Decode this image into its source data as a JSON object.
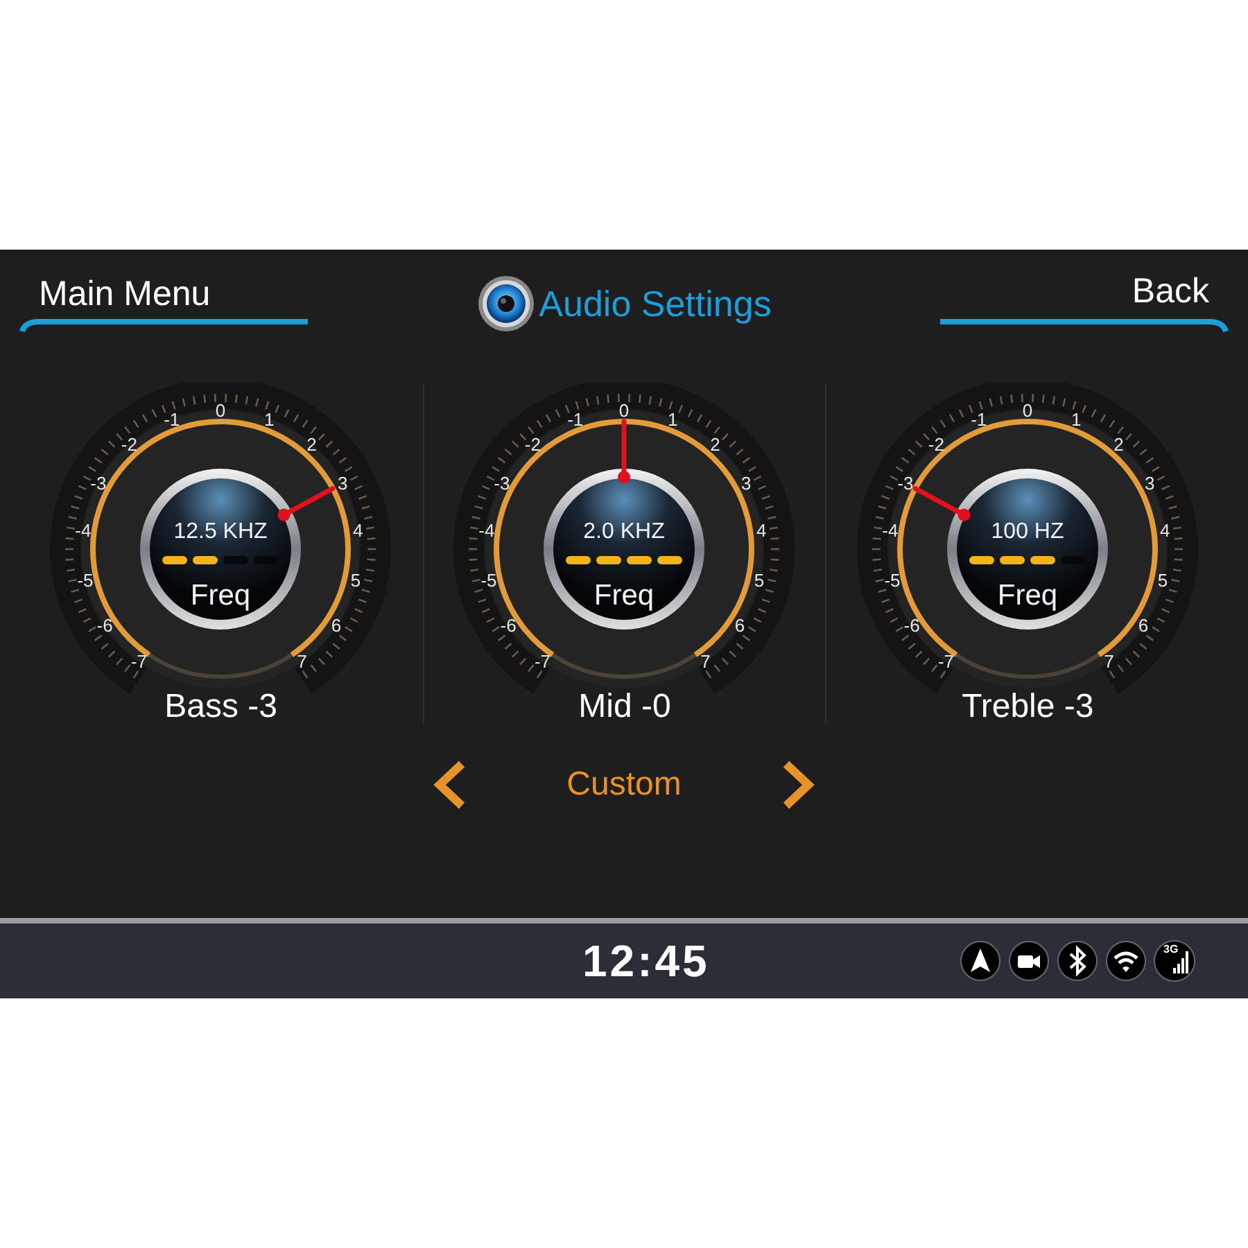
{
  "header": {
    "left_button": "Main Menu",
    "title": "Audio Settings",
    "right_button": "Back"
  },
  "bands": [
    {
      "label": "Bass -3",
      "frequency": "12.5 KHZ",
      "knob_label": "Freq",
      "level": 0.714,
      "segments": [
        {
          "on": true
        },
        {
          "on": true
        },
        {
          "on": false
        },
        {
          "on": false
        }
      ],
      "scale": [
        "-7",
        "-6",
        "-5",
        "-4",
        "-3",
        "-2",
        "-1",
        "0",
        "1",
        "2",
        "3",
        "4",
        "5",
        "6",
        "7"
      ]
    },
    {
      "label": "Mid -0",
      "frequency": "2.0 KHZ",
      "knob_label": "Freq",
      "level": 0.5,
      "segments": [
        {
          "on": true
        },
        {
          "on": true
        },
        {
          "on": true
        },
        {
          "on": true
        }
      ],
      "scale": [
        "-7",
        "-6",
        "-5",
        "-4",
        "-3",
        "-2",
        "-1",
        "0",
        "1",
        "2",
        "3",
        "4",
        "5",
        "6",
        "7"
      ]
    },
    {
      "label": "Treble -3",
      "frequency": "100 HZ",
      "knob_label": "Freq",
      "level": 0.286,
      "segments": [
        {
          "on": true
        },
        {
          "on": true
        },
        {
          "on": true
        },
        {
          "on": false
        }
      ],
      "scale": [
        "-7",
        "-6",
        "-5",
        "-4",
        "-3",
        "-2",
        "-1",
        "0",
        "1",
        "2",
        "3",
        "4",
        "5",
        "6",
        "7"
      ]
    }
  ],
  "preset": {
    "name": "Custom"
  },
  "status_bar": {
    "time": "12:45",
    "network_label": "3G"
  }
}
